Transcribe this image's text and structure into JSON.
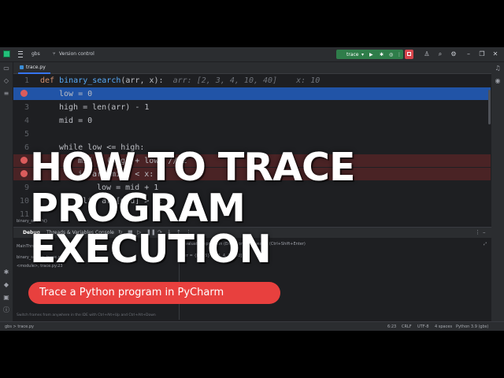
{
  "titlebar": {
    "project": "gbs",
    "vcs": "Version control",
    "run_config": "trace",
    "icons": [
      "run-icon",
      "debug-icon",
      "coverage-icon",
      "more-icon",
      "stop-icon",
      "profile-icon",
      "search-icon",
      "settings-icon",
      "minimize-icon",
      "restore-icon",
      "close-icon"
    ]
  },
  "tabs": [
    {
      "label": "trace.py"
    }
  ],
  "editor": {
    "lines": [
      {
        "num": "1"
      },
      {
        "num": "2"
      },
      {
        "num": "3"
      },
      {
        "num": "4"
      },
      {
        "num": "5"
      },
      {
        "num": "6"
      },
      {
        "num": "7"
      },
      {
        "num": "8"
      },
      {
        "num": "9"
      },
      {
        "num": "10"
      },
      {
        "num": "11"
      }
    ],
    "code": {
      "l1_def": "def",
      "l1_name": "binary_search",
      "l1_params": "(arr, x):",
      "l1_hint": "arr: [2, 3, 4, 10, 40]    x: 10",
      "l2": "low = 0",
      "l3": "high = len(arr) - 1",
      "l4": "mid = 0",
      "l6": "while low <= high:",
      "l7": "mid = (high + low) // 2",
      "l8": "if arr[mid] < x:",
      "l9": "low = mid + 1",
      "l10": "elif arr[mid] > x:"
    },
    "breadcrumb": "binary_search()"
  },
  "debug": {
    "tabs": [
      "Debug",
      "Threads & Variables",
      "Console"
    ],
    "thread": "MainThread",
    "frames": [
      "binary_search, trace.py:2",
      "<module>, trace.py:23"
    ],
    "eval_placeholder": "Evaluate expression (Enter) or add a watch (Ctrl+Shift+Enter)",
    "var_row": "arr = {list: 5} [2, 3, 4, 10, 40]",
    "hint": "Switch frames from anywhere in the IDE with Ctrl+Alt+Up and Ctrl+Alt+Down"
  },
  "status": {
    "path": "gbs > trace.py",
    "position": "6:23",
    "line_sep": "CRLF",
    "encoding": "UTF-8",
    "indent": "4 spaces",
    "interpreter": "Python 3.9 (gbs)"
  },
  "overlay": {
    "title_lines": [
      "HOW TO TRACE",
      "PROGRAM",
      "EXECUTION"
    ],
    "subtitle": "Trace a Python program in PyCharm",
    "accent": "#e8403e"
  }
}
